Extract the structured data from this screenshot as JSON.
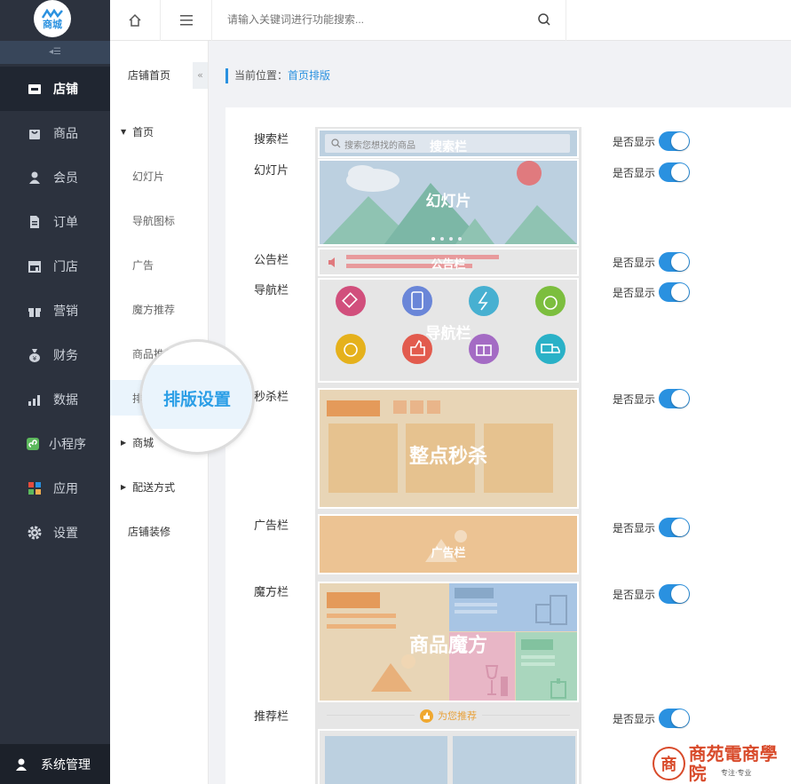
{
  "logo": {
    "text": "商城"
  },
  "leftnav": {
    "items": [
      {
        "label": "店铺",
        "icon": "store-icon",
        "active": true
      },
      {
        "label": "商品",
        "icon": "bag-icon"
      },
      {
        "label": "会员",
        "icon": "user-icon"
      },
      {
        "label": "订单",
        "icon": "document-icon"
      },
      {
        "label": "门店",
        "icon": "shop-icon"
      },
      {
        "label": "营销",
        "icon": "gift-icon"
      },
      {
        "label": "财务",
        "icon": "money-bag-icon"
      },
      {
        "label": "数据",
        "icon": "chart-icon"
      },
      {
        "label": "小程序",
        "icon": "miniprogram-icon"
      },
      {
        "label": "应用",
        "icon": "apps-icon"
      },
      {
        "label": "设置",
        "icon": "gear-icon"
      }
    ],
    "system": "系统管理"
  },
  "topbar": {
    "search_placeholder": "请输入关键词进行功能搜索..."
  },
  "subnav": {
    "items": [
      {
        "label": "店铺首页",
        "level": 0
      },
      {
        "label": "首页",
        "level": 1,
        "expanded": true
      },
      {
        "label": "幻灯片",
        "level": 2
      },
      {
        "label": "导航图标",
        "level": 2
      },
      {
        "label": "广告",
        "level": 2
      },
      {
        "label": "魔方推荐",
        "level": 2
      },
      {
        "label": "商品推荐",
        "level": 2
      },
      {
        "label": "排版设置",
        "level": 2,
        "selected": true
      },
      {
        "label": "商城",
        "level": 1,
        "expanded": false
      },
      {
        "label": "配送方式",
        "level": 1,
        "expanded": false
      },
      {
        "label": "店铺装修",
        "level": 0
      }
    ],
    "magnified": "排版设置"
  },
  "breadcrumb": {
    "prefix": "当前位置：",
    "current": "首页排版"
  },
  "layout": {
    "show_label": "是否显示",
    "rows": [
      {
        "label": "搜索栏",
        "enabled": true
      },
      {
        "label": "幻灯片",
        "enabled": true
      },
      {
        "label": "公告栏",
        "enabled": true
      },
      {
        "label": "导航栏",
        "enabled": true
      },
      {
        "label": "秒杀栏",
        "enabled": true
      },
      {
        "label": "广告栏",
        "enabled": true
      },
      {
        "label": "魔方栏",
        "enabled": true
      },
      {
        "label": "推荐栏",
        "enabled": true
      }
    ]
  },
  "preview": {
    "search_hint": "搜索您想找的商品",
    "search_name": "搜索栏",
    "slider_name": "幻灯片",
    "notice_name": "公告栏",
    "nav_name": "导航栏",
    "seckill_name": "整点秒杀",
    "ad_name": "广告栏",
    "cube_name": "商品魔方",
    "recommend_name": "为您推荐"
  },
  "brand": {
    "name": "商苑電商學院",
    "slogan": "专注·专业"
  },
  "colors": {
    "accent": "#2a91e0",
    "nav_bg": "#2c323e"
  }
}
